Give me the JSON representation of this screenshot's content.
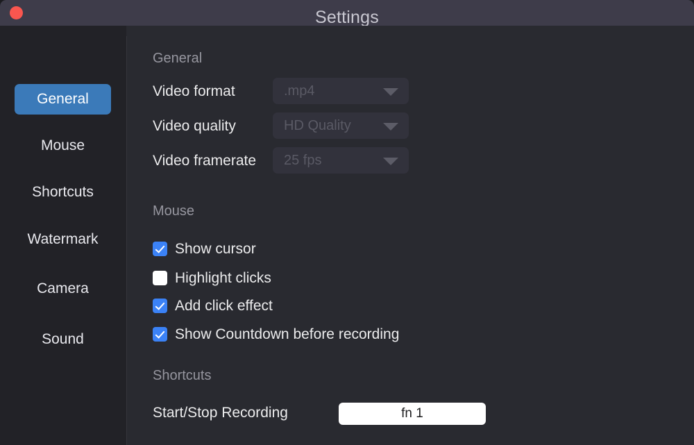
{
  "window": {
    "title": "Settings",
    "close_button": "close-button"
  },
  "sidebar": {
    "items": [
      {
        "label": "General",
        "selected": true
      },
      {
        "label": "Mouse",
        "selected": false
      },
      {
        "label": "Shortcuts",
        "selected": false
      },
      {
        "label": "Watermark",
        "selected": false
      },
      {
        "label": "Camera",
        "selected": false
      },
      {
        "label": "Sound",
        "selected": false
      }
    ]
  },
  "content": {
    "general": {
      "header": "General",
      "fields": [
        {
          "label": "Video format",
          "value": ".mp4"
        },
        {
          "label": "Video quality",
          "value": "HD Quality"
        },
        {
          "label": "Video framerate",
          "value": "25 fps"
        }
      ]
    },
    "mouse": {
      "header": "Mouse",
      "checkboxes": [
        {
          "label": "Show cursor",
          "checked": true
        },
        {
          "label": "Highlight clicks",
          "checked": false
        },
        {
          "label": "Add click effect",
          "checked": true
        },
        {
          "label": "Show Countdown before recording",
          "checked": true
        }
      ]
    },
    "shortcuts": {
      "header": "Shortcuts",
      "label": "Start/Stop Recording",
      "value": "fn 1"
    }
  },
  "colors": {
    "titlebar": "#3e3c4a",
    "sidebar": "#222227",
    "content": "#292a30",
    "accent_selected": "#3b7ab9",
    "accent_checkbox": "#3b82f6",
    "close": "#f9564f"
  }
}
